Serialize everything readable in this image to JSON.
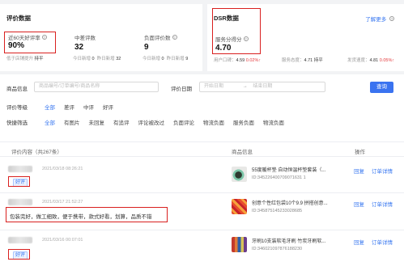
{
  "stats": {
    "title": "评价数据",
    "good_rate": {
      "label": "近60天好评率",
      "value": "90%",
      "sub_label": "低于店铺提升",
      "sub_value": "持平"
    },
    "neutral": {
      "label": "中差评数",
      "value": "32",
      "sub_label": "今日新增",
      "sub_value": "0",
      "sub2_label": "昨日新增",
      "sub2_value": "32"
    },
    "negative": {
      "label": "负面评价数",
      "value": "9",
      "sub_label": "今日新增",
      "sub_value": "0",
      "sub2_label": "昨日新增",
      "sub2_value": "9"
    }
  },
  "dsr": {
    "title": "DSR数据",
    "more_link": "了解更多",
    "score_label": "服务分得分",
    "score_value": "4.70",
    "subs": [
      {
        "label": "用户口碑：",
        "value": "4.59",
        "delta": "0.02%",
        "arrow": "↑"
      },
      {
        "label": "服务态度：",
        "value": "4.71",
        "delta": "持平",
        "arrow": ""
      },
      {
        "label": "发货速度：",
        "value": "4.81",
        "delta": "0.05%",
        "arrow": "↑"
      }
    ]
  },
  "filters": {
    "product_label": "商品信息",
    "product_placeholder": "商品编号/订单编号/商品名称",
    "date_label": "评价日期",
    "start_placeholder": "开始日期",
    "date_sep": "→",
    "end_placeholder": "结束日期",
    "search_button": "查询",
    "level_label": "评价等级",
    "levels": [
      "全部",
      "差评",
      "中评",
      "好评"
    ],
    "quick_label": "快捷筛选",
    "quick": [
      "全部",
      "有图片",
      "未回复",
      "有追评",
      "评论被改过",
      "负面评论",
      "物流负面",
      "服务负面",
      "物流负面"
    ]
  },
  "table": {
    "col_content": "评价内容（共267条）",
    "col_product": "商品信息",
    "col_ops": "操作",
    "rows": [
      {
        "date": "2021/03/18 08:26:21",
        "tag": "好评",
        "text": "",
        "product_name": "55度暖杯垫 自动恒温杯垫套装（...",
        "product_id": "ID:345226400709071631 1",
        "reply": "回复",
        "detail": "订单详情"
      },
      {
        "date": "2021/03/17 21:52:27",
        "tag": "",
        "text": "包装完好，做工细致，便于携带，款式好看，划算，品质不错",
        "product_name": "创意个性红包袋10个9.9 拼搭创意...",
        "product_id": "ID:345875145233028685",
        "reply": "回复",
        "detail": "订单详情"
      },
      {
        "date": "2021/03/16 00:07:01",
        "tag": "好评",
        "text": "",
        "product_name": "牙刷10支装软毛牙刷 竹炭牙刷软...",
        "product_id": "ID:346021097876188230",
        "reply": "回复",
        "detail": "订单详情"
      }
    ]
  }
}
